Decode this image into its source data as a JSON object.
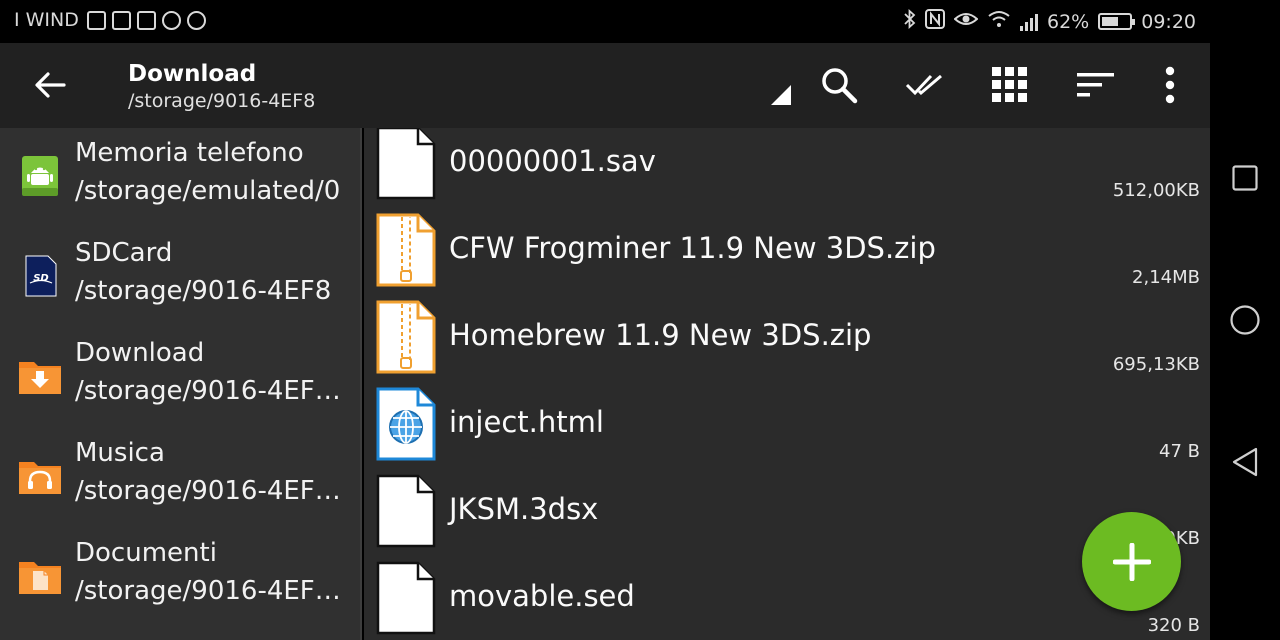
{
  "status_bar": {
    "carrier": "I WIND",
    "notification_icons": [
      "mail-icon",
      "instagram-icon",
      "gmail-icon",
      "pinterest-icon",
      "whatsapp-icon"
    ],
    "system_icons": [
      "bluetooth-icon",
      "nfc-icon",
      "eye-comfort-icon",
      "wifi-icon",
      "signal-icon",
      "battery-icon"
    ],
    "battery": "62%",
    "battery_level": 0.62,
    "time": "09:20"
  },
  "toolbar": {
    "title": "Download",
    "subtitle": "/storage/9016-4EF8",
    "actions": [
      "search-icon",
      "select-all-icon",
      "grid-view-icon",
      "sort-icon",
      "more-options-icon"
    ]
  },
  "sidebar": {
    "items": [
      {
        "label": "Memoria telefono",
        "path": "/storage/emulated/0",
        "icon": "android-storage-icon"
      },
      {
        "label": "SDCard",
        "path": "/storage/9016-4EF8",
        "icon": "sdcard-icon"
      },
      {
        "label": "Download",
        "path": "/storage/9016-4EF8…",
        "icon": "download-folder-icon"
      },
      {
        "label": "Musica",
        "path": "/storage/9016-4EF8…",
        "icon": "music-folder-icon"
      },
      {
        "label": "Documenti",
        "path": "/storage/9016-4EF8…",
        "icon": "documents-folder-icon"
      }
    ]
  },
  "files": [
    {
      "name": "00000001.sav",
      "size": "512,00KB",
      "type": "file"
    },
    {
      "name": "CFW Frogminer 11.9 New 3DS.zip",
      "size": "2,14MB",
      "type": "zip"
    },
    {
      "name": "Homebrew 11.9 New 3DS.zip",
      "size": "695,13KB",
      "type": "zip"
    },
    {
      "name": "inject.html",
      "size": "47 B",
      "type": "html"
    },
    {
      "name": "JKSM.3dsx",
      "size": "0KB",
      "type": "file"
    },
    {
      "name": "movable.sed",
      "size": "320 B",
      "type": "file"
    }
  ],
  "fab": {
    "icon": "plus-icon",
    "color": "#6cbb22"
  },
  "nav": [
    "recents-square-icon",
    "home-circle-icon",
    "back-triangle-icon"
  ],
  "colors": {
    "accent": "#6cbb22",
    "folder": "#f58220",
    "zip": "#f0a030",
    "html": "#1e88d8"
  }
}
